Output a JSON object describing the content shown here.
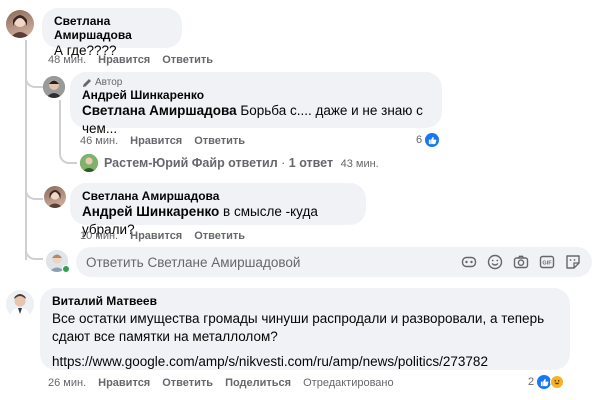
{
  "actions": {
    "like": "Нравится",
    "reply": "Ответить",
    "edited": "Отредактировано"
  },
  "comments": [
    {
      "author": "Светлана Амиршадова",
      "text": "А где????",
      "time": "48 мин."
    },
    {
      "badge": "Автор",
      "author": "Андрей Шинкаренко",
      "mention": "Светлана Амиршадова",
      "text": " Борьба с.... даже и не знаю с чем...",
      "time": "46 мин.",
      "reactions": "6"
    },
    {
      "author": "Светлана Амиршадова",
      "mention": "Андрей Шинкаренко",
      "text": " в смысле -куда убрали?",
      "time": "10 мин."
    },
    {
      "author": "Виталий Матвеев",
      "text": "Все остатки имущества громады чинуши распродали и разворовали, а теперь сдают все памятки на металлолом?",
      "link": "https://www.google.com/amp/s/nikvesti.com/ru/amp/news/politics/273782",
      "time": "26 мин.",
      "reactions": "2"
    }
  ],
  "reply_summary": {
    "name": "Растем-Юрий Файр",
    "action": " ответил",
    "sep": " · ",
    "count": "1 ответ",
    "time": "43 мин."
  },
  "reply_box": {
    "placeholder": "Ответить Светлане Амиршадовой"
  },
  "colors": {
    "like": "#1877f2",
    "bubble": "#f0f2f5",
    "muted": "#65676b",
    "online": "#31a24c"
  },
  "icons": [
    "pencil-icon",
    "like-icon",
    "haha-icon",
    "sticker-icon",
    "emoji-icon",
    "camera-icon",
    "gif-icon",
    "sticker-face-icon"
  ]
}
